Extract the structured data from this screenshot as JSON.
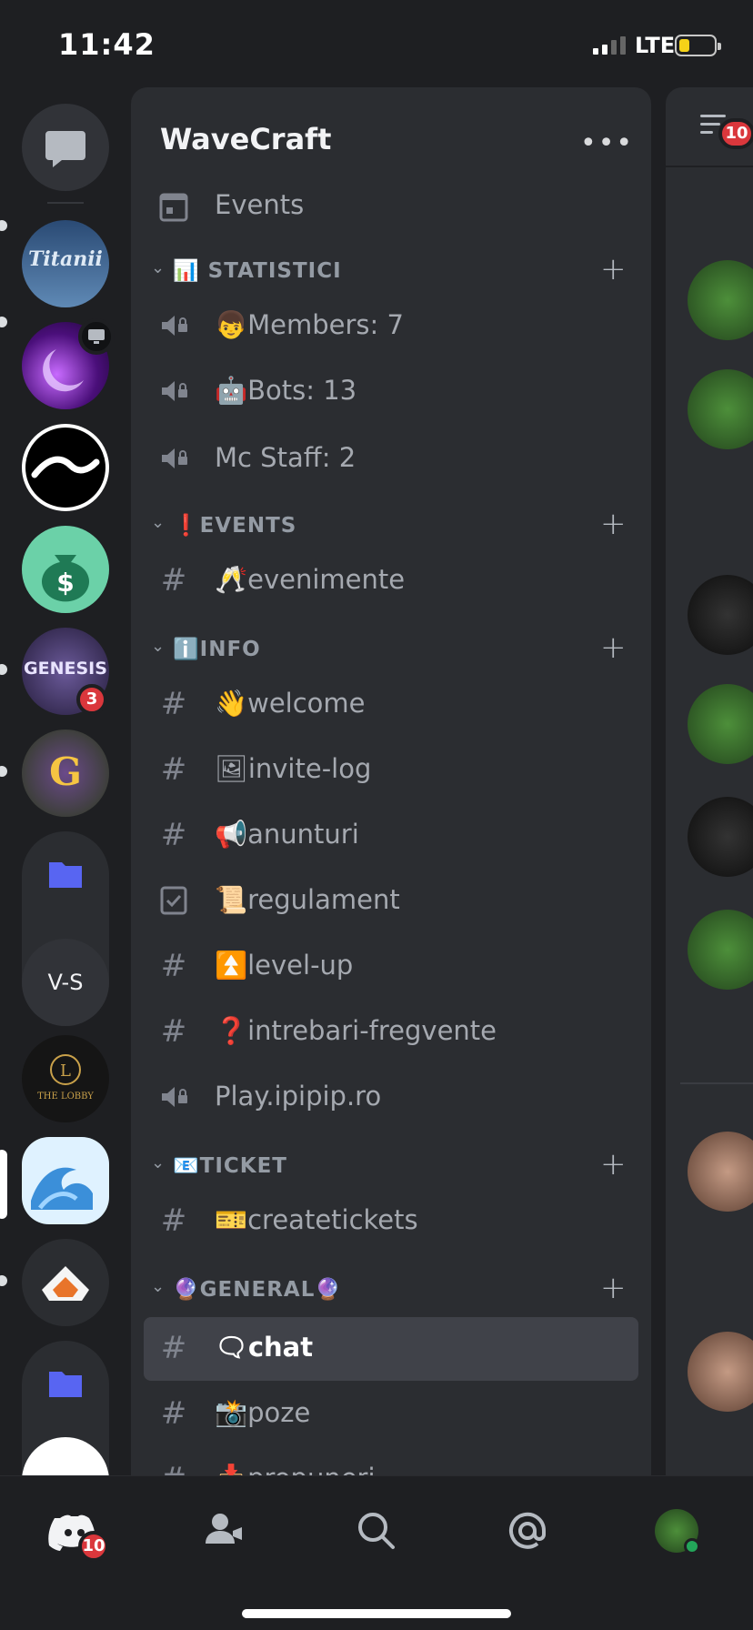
{
  "status_bar": {
    "time": "11:42",
    "network": "LTE"
  },
  "rail": {
    "dm_icon": "chat-bubble-icon",
    "servers": [
      {
        "name": "Titanii",
        "label": "Titanii"
      },
      {
        "name": "purple-moon-server",
        "label": ""
      },
      {
        "name": "wave-server",
        "label": ""
      },
      {
        "name": "money-bag-server",
        "label": ""
      },
      {
        "name": "Genesis",
        "label": "GENESIS",
        "badge": "3"
      },
      {
        "name": "G-server",
        "label": "G"
      },
      {
        "name": "V-S",
        "label": "V-S"
      },
      {
        "name": "The Lobby",
        "label": "THE LOBBY"
      },
      {
        "name": "WaveCraft",
        "label": ""
      },
      {
        "name": "fox-server",
        "label": ""
      }
    ]
  },
  "panel": {
    "server_name": "WaveCraft",
    "events_label": "Events",
    "categories": {
      "statistici": "STATISTICI",
      "events": "EVENTS",
      "info": "INFO",
      "ticket": "TICKET",
      "general": "GENERAL"
    },
    "channels": {
      "members": "Members: 7",
      "bots": "Bots: 13",
      "mc_staff": "Mc Staff: 2",
      "evenimente": "evenimente",
      "welcome": "welcome",
      "invite_log": "invite-log",
      "anunturi": "anunturi",
      "regulament": "regulament",
      "level_up": "level-up",
      "intrebari": "intrebari-fregvente",
      "play": "Play.ipipip.ro",
      "createtickets": "createtickets",
      "chat": "chat",
      "poze": "poze",
      "propuneri": "propuneri"
    }
  },
  "members_panel": {
    "badge": "10"
  },
  "bottom_nav": {
    "home_badge": "10"
  },
  "colors": {
    "accent": "#5865f2",
    "badge": "#da373c",
    "online": "#23a55a"
  }
}
